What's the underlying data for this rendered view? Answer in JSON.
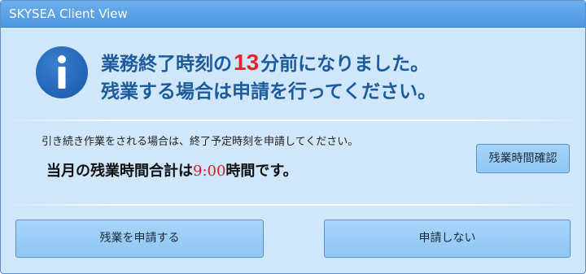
{
  "window": {
    "title": "SKYSEA Client View"
  },
  "message": {
    "line1_before": "業務終了時刻の",
    "minutes": "13",
    "line1_after": "分前になりました。",
    "line2": "残業する場合は申請を行ってください。"
  },
  "info": {
    "instruction": "引き続き作業をされる場合は、終了予定時刻を申請してください。",
    "total_prefix": "当月の残業時間合計は",
    "total_hours": "9:00",
    "total_suffix": "時間です。"
  },
  "buttons": {
    "check_overtime": "残業時間確認",
    "apply_overtime": "残業を申請する",
    "do_not_apply": "申請しない"
  },
  "icons": {
    "info": "info-icon"
  },
  "colors": {
    "titlebar": "#5aa2e6",
    "background": "#cfe6fb",
    "message_text": "#1d5c9c",
    "highlight_red": "#e5232a",
    "button": "#9ccdf6"
  }
}
